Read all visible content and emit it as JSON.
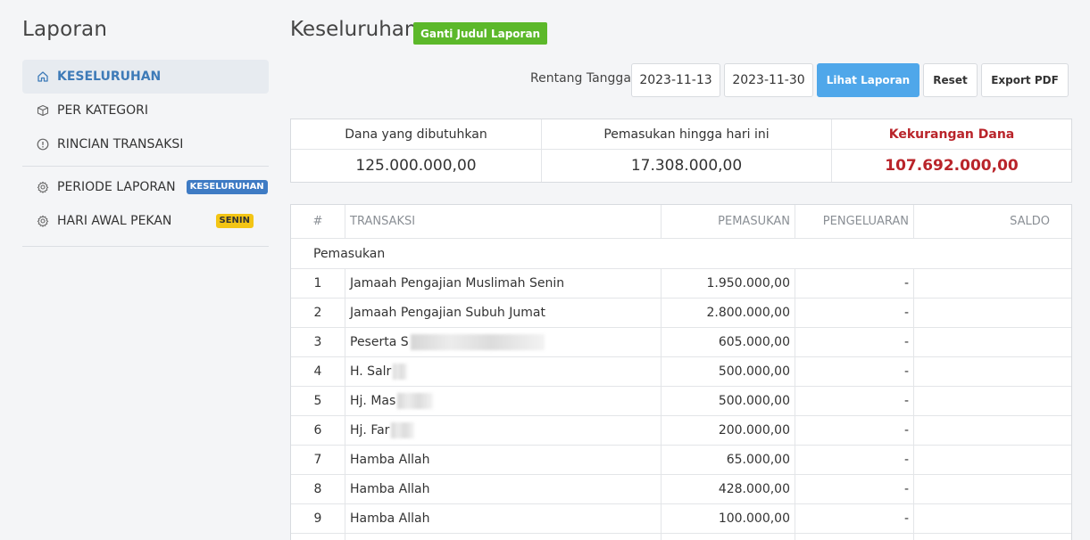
{
  "sidebar": {
    "title": "Laporan",
    "items": [
      {
        "label": "KESELURUHAN",
        "icon": "home-icon"
      },
      {
        "label": "PER KATEGORI",
        "icon": "box-icon"
      },
      {
        "label": "RINCIAN TRANSAKSI",
        "icon": "info-circle-icon"
      }
    ],
    "settings": [
      {
        "label": "PERIODE LAPORAN",
        "icon": "gear-icon",
        "badge": "KESELURUHAN",
        "badge_color": "#3e7bc4"
      },
      {
        "label": "HARI AWAL PEKAN",
        "icon": "gear-icon",
        "badge": "SENIN",
        "badge_color": "#f3c515"
      }
    ]
  },
  "header": {
    "title": "Keseluruhan",
    "rename_label": "Ganti Judul Laporan"
  },
  "filter": {
    "range_label": "Rentang Tanggal",
    "start_date": "2023-11-13",
    "end_date": "2023-11-30",
    "view_label": "Lihat Laporan",
    "reset_label": "Reset",
    "export_label": "Export PDF"
  },
  "summary": {
    "needed_label": "Dana yang dibutuhkan",
    "needed_value": "125.000.000,00",
    "income_label": "Pemasukan hingga hari ini",
    "income_value": "17.308.000,00",
    "shortfall_label": "Kekurangan Dana",
    "shortfall_value": "107.692.000,00",
    "shortfall_color": "#b9242a"
  },
  "table": {
    "columns": [
      "#",
      "TRANSAKSI",
      "PEMASUKAN",
      "PENGELUARAN",
      "SALDO"
    ],
    "section_label": "Pemasukan",
    "rows": [
      {
        "no": "1",
        "name": "Jamaah Pengajian Muslimah Senin",
        "income": "1.950.000,00",
        "expense": "-",
        "balance": ""
      },
      {
        "no": "2",
        "name": "Jamaah Pengajian Subuh Jumat",
        "income": "2.800.000,00",
        "expense": "-",
        "balance": ""
      },
      {
        "no": "3",
        "name": "Peserta S",
        "income": "605.000,00",
        "expense": "-",
        "balance": ""
      },
      {
        "no": "4",
        "name": "H. Salr",
        "income": "500.000,00",
        "expense": "-",
        "balance": ""
      },
      {
        "no": "5",
        "name": "Hj. Mas",
        "income": "500.000,00",
        "expense": "-",
        "balance": ""
      },
      {
        "no": "6",
        "name": "Hj. Far",
        "income": "200.000,00",
        "expense": "-",
        "balance": ""
      },
      {
        "no": "7",
        "name": "Hamba Allah",
        "income": "65.000,00",
        "expense": "-",
        "balance": ""
      },
      {
        "no": "8",
        "name": "Hamba Allah",
        "income": "428.000,00",
        "expense": "-",
        "balance": ""
      },
      {
        "no": "9",
        "name": "Hamba Allah",
        "income": "100.000,00",
        "expense": "-",
        "balance": ""
      }
    ]
  }
}
